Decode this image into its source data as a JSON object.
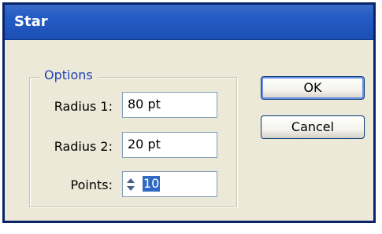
{
  "window": {
    "title": "Star"
  },
  "options_group": {
    "legend": "Options",
    "radius1": {
      "label": "Radius 1:",
      "value": "80 pt"
    },
    "radius2": {
      "label": "Radius 2:",
      "value": "20 pt"
    },
    "points": {
      "label": "Points:",
      "value": "10"
    }
  },
  "buttons": {
    "ok_label": "OK",
    "cancel_label": "Cancel"
  },
  "colors": {
    "titlebar": "#245cc5",
    "dialog_bg": "#ece9d8",
    "legend_text": "#1f3fb8",
    "selection": "#316ac5"
  }
}
